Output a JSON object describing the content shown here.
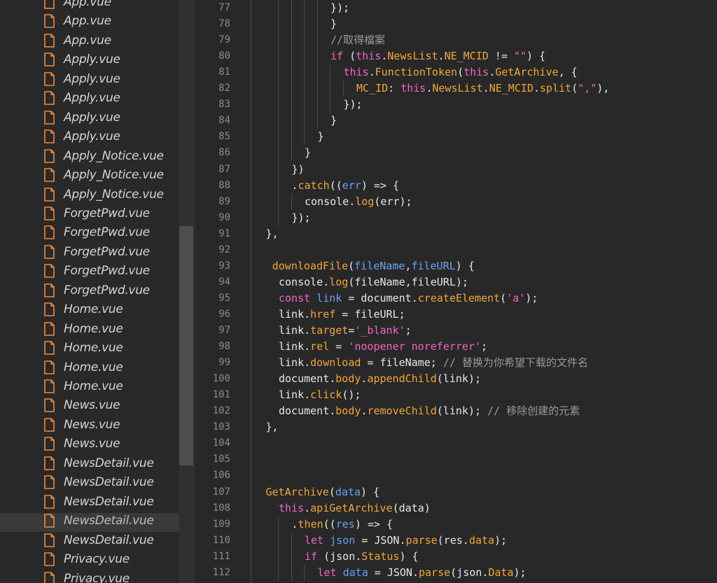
{
  "sidebar": {
    "files": [
      {
        "name": "App.vue"
      },
      {
        "name": "App.vue"
      },
      {
        "name": "App.vue"
      },
      {
        "name": "Apply.vue"
      },
      {
        "name": "Apply.vue"
      },
      {
        "name": "Apply.vue"
      },
      {
        "name": "Apply.vue"
      },
      {
        "name": "Apply.vue"
      },
      {
        "name": "Apply_Notice.vue"
      },
      {
        "name": "Apply_Notice.vue"
      },
      {
        "name": "Apply_Notice.vue"
      },
      {
        "name": "ForgetPwd.vue"
      },
      {
        "name": "ForgetPwd.vue"
      },
      {
        "name": "ForgetPwd.vue"
      },
      {
        "name": "ForgetPwd.vue"
      },
      {
        "name": "ForgetPwd.vue"
      },
      {
        "name": "Home.vue"
      },
      {
        "name": "Home.vue"
      },
      {
        "name": "Home.vue"
      },
      {
        "name": "Home.vue"
      },
      {
        "name": "Home.vue"
      },
      {
        "name": "News.vue"
      },
      {
        "name": "News.vue"
      },
      {
        "name": "News.vue"
      },
      {
        "name": "NewsDetail.vue"
      },
      {
        "name": "NewsDetail.vue"
      },
      {
        "name": "NewsDetail.vue"
      },
      {
        "name": "NewsDetail.vue",
        "selected": true
      },
      {
        "name": "NewsDetail.vue"
      },
      {
        "name": "Privacy.vue"
      },
      {
        "name": "Privacy.vue"
      }
    ],
    "file_icon_color": "#f08a3c",
    "file_icon": "file-icon"
  },
  "editor": {
    "lines": [
      {
        "n": "77",
        "indent": 4,
        "t": [
          [
            "p",
            "});"
          ]
        ]
      },
      {
        "n": "78",
        "indent": 4,
        "t": [
          [
            "p",
            "}"
          ]
        ]
      },
      {
        "n": "79",
        "indent": 4,
        "t": [
          [
            "c",
            "//取得檔案"
          ]
        ]
      },
      {
        "n": "80",
        "indent": 4,
        "t": [
          [
            "k",
            "if"
          ],
          [
            "p",
            " ("
          ],
          [
            "k",
            "this"
          ],
          [
            "p",
            "."
          ],
          [
            "f",
            "NewsList"
          ],
          [
            "p",
            "."
          ],
          [
            "f",
            "NE_MCID"
          ],
          [
            "p",
            " != "
          ],
          [
            "s",
            "\"\""
          ],
          [
            "p",
            ") {"
          ]
        ]
      },
      {
        "n": "81",
        "indent": 5,
        "t": [
          [
            "k",
            "this"
          ],
          [
            "p",
            "."
          ],
          [
            "f",
            "FunctionToken"
          ],
          [
            "p",
            "("
          ],
          [
            "k",
            "this"
          ],
          [
            "p",
            "."
          ],
          [
            "f",
            "GetArchive"
          ],
          [
            "p",
            ", {"
          ]
        ]
      },
      {
        "n": "82",
        "indent": 6,
        "t": [
          [
            "f",
            "MC_ID"
          ],
          [
            "p",
            ": "
          ],
          [
            "k",
            "this"
          ],
          [
            "p",
            "."
          ],
          [
            "f",
            "NewsList"
          ],
          [
            "p",
            "."
          ],
          [
            "f",
            "NE_MCID"
          ],
          [
            "p",
            "."
          ],
          [
            "f",
            "split"
          ],
          [
            "p",
            "("
          ],
          [
            "s",
            "\",\""
          ],
          [
            "p",
            "),"
          ]
        ]
      },
      {
        "n": "83",
        "indent": 5,
        "t": [
          [
            "p",
            "});"
          ]
        ]
      },
      {
        "n": "84",
        "indent": 4,
        "t": [
          [
            "p",
            "}"
          ]
        ]
      },
      {
        "n": "85",
        "indent": 3,
        "t": [
          [
            "p",
            "}"
          ]
        ]
      },
      {
        "n": "86",
        "indent": 2,
        "t": [
          [
            "p",
            "}"
          ]
        ]
      },
      {
        "n": "87",
        "indent": 1,
        "t": [
          [
            "p",
            "})"
          ]
        ]
      },
      {
        "n": "88",
        "indent": 1,
        "t": [
          [
            "p",
            "."
          ],
          [
            "f",
            "catch"
          ],
          [
            "p",
            "(("
          ],
          [
            "v",
            "err"
          ],
          [
            "p",
            ") => {"
          ]
        ]
      },
      {
        "n": "89",
        "indent": 2,
        "t": [
          [
            "p",
            "console."
          ],
          [
            "f",
            "log"
          ],
          [
            "p",
            "(err);"
          ]
        ]
      },
      {
        "n": "90",
        "indent": 1,
        "t": [
          [
            "p",
            "});"
          ]
        ]
      },
      {
        "n": "91",
        "indent": -1,
        "t": [
          [
            "p",
            "},"
          ]
        ]
      },
      {
        "n": "92",
        "indent": 0,
        "t": []
      },
      {
        "n": "93",
        "indent": -0.5,
        "t": [
          [
            "f",
            "downloadFile"
          ],
          [
            "p",
            "("
          ],
          [
            "v",
            "fileName"
          ],
          [
            "p",
            ","
          ],
          [
            "v",
            "fileURL"
          ],
          [
            "p",
            ") {"
          ]
        ]
      },
      {
        "n": "94",
        "indent": 0,
        "t": [
          [
            "p",
            "console."
          ],
          [
            "f",
            "log"
          ],
          [
            "p",
            "(fileName,fileURL);"
          ]
        ]
      },
      {
        "n": "95",
        "indent": 0,
        "t": [
          [
            "k",
            "const"
          ],
          [
            "p",
            " "
          ],
          [
            "v",
            "link"
          ],
          [
            "p",
            " = document."
          ],
          [
            "f",
            "createElement"
          ],
          [
            "p",
            "("
          ],
          [
            "s",
            "'a'"
          ],
          [
            "p",
            ");"
          ]
        ]
      },
      {
        "n": "96",
        "indent": 0,
        "t": [
          [
            "p",
            "link."
          ],
          [
            "f",
            "href"
          ],
          [
            "p",
            " = fileURL;"
          ]
        ]
      },
      {
        "n": "97",
        "indent": 0,
        "t": [
          [
            "p",
            "link."
          ],
          [
            "f",
            "target"
          ],
          [
            "p",
            "="
          ],
          [
            "s",
            "'_blank'"
          ],
          [
            "p",
            ";"
          ]
        ]
      },
      {
        "n": "98",
        "indent": 0,
        "t": [
          [
            "p",
            "link."
          ],
          [
            "f",
            "rel"
          ],
          [
            "p",
            " = "
          ],
          [
            "s",
            "'noopener noreferrer'"
          ],
          [
            "p",
            ";"
          ]
        ]
      },
      {
        "n": "99",
        "indent": 0,
        "t": [
          [
            "p",
            "link."
          ],
          [
            "f",
            "download"
          ],
          [
            "p",
            " = fileName; "
          ],
          [
            "c",
            "// 替换为你希望下载的文件名"
          ]
        ]
      },
      {
        "n": "100",
        "indent": 0,
        "t": [
          [
            "p",
            "document."
          ],
          [
            "f",
            "body"
          ],
          [
            "p",
            "."
          ],
          [
            "f",
            "appendChild"
          ],
          [
            "p",
            "(link);"
          ]
        ]
      },
      {
        "n": "101",
        "indent": 0,
        "t": [
          [
            "p",
            "link."
          ],
          [
            "f",
            "click"
          ],
          [
            "p",
            "();"
          ]
        ]
      },
      {
        "n": "102",
        "indent": 0,
        "t": [
          [
            "p",
            "document."
          ],
          [
            "f",
            "body"
          ],
          [
            "p",
            "."
          ],
          [
            "f",
            "removeChild"
          ],
          [
            "p",
            "(link); "
          ],
          [
            "c",
            "// 移除创建的元素"
          ]
        ]
      },
      {
        "n": "103",
        "indent": -1,
        "t": [
          [
            "p",
            "},"
          ]
        ]
      },
      {
        "n": "104",
        "indent": 0,
        "t": []
      },
      {
        "n": "105",
        "indent": 0,
        "t": []
      },
      {
        "n": "106",
        "indent": 0,
        "t": []
      },
      {
        "n": "107",
        "indent": -1,
        "t": [
          [
            "f",
            "GetArchive"
          ],
          [
            "p",
            "("
          ],
          [
            "v",
            "data"
          ],
          [
            "p",
            ") {"
          ]
        ]
      },
      {
        "n": "108",
        "indent": 0,
        "t": [
          [
            "k",
            "this"
          ],
          [
            "p",
            "."
          ],
          [
            "f",
            "apiGetArchive"
          ],
          [
            "p",
            "(data)"
          ]
        ]
      },
      {
        "n": "109",
        "indent": 1,
        "t": [
          [
            "p",
            "."
          ],
          [
            "f",
            "then"
          ],
          [
            "p",
            "(("
          ],
          [
            "v",
            "res"
          ],
          [
            "p",
            ") => {"
          ]
        ]
      },
      {
        "n": "110",
        "indent": 2,
        "t": [
          [
            "k",
            "let"
          ],
          [
            "p",
            " "
          ],
          [
            "v",
            "json"
          ],
          [
            "p",
            " = JSON."
          ],
          [
            "f",
            "parse"
          ],
          [
            "p",
            "(res."
          ],
          [
            "f",
            "data"
          ],
          [
            "p",
            ");"
          ]
        ]
      },
      {
        "n": "111",
        "indent": 2,
        "t": [
          [
            "k",
            "if"
          ],
          [
            "p",
            " (json."
          ],
          [
            "f",
            "Status"
          ],
          [
            "p",
            ") {"
          ]
        ]
      },
      {
        "n": "112",
        "indent": 3,
        "t": [
          [
            "k",
            "let"
          ],
          [
            "p",
            " "
          ],
          [
            "v",
            "data"
          ],
          [
            "p",
            " = JSON."
          ],
          [
            "f",
            "parse"
          ],
          [
            "p",
            "(json."
          ],
          [
            "f",
            "Data"
          ],
          [
            "p",
            ");"
          ]
        ]
      }
    ]
  }
}
